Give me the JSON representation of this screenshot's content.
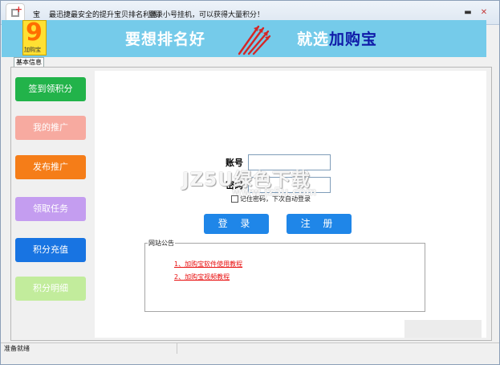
{
  "titlebar": {
    "app_name": "宝",
    "slogan1": "最迅捷最安全的提升宝贝排名利器！",
    "slogan2": "登录小号挂机，可以获得大量积分！",
    "min_glyph": "▬",
    "close_glyph": "✕"
  },
  "banner": {
    "logo_big": "9",
    "logo_small": "加购宝",
    "text1": "要想排名好",
    "text2_prefix": "就选",
    "brand": "加购宝"
  },
  "tabs": [
    {
      "label": "基本信息"
    }
  ],
  "sidebar": {
    "items": [
      {
        "label": "签到领积分",
        "color": "#22b34a"
      },
      {
        "label": "我的推广",
        "color": "#f7aaa0"
      },
      {
        "label": "发布推广",
        "color": "#f57d18"
      },
      {
        "label": "领取任务",
        "color": "#c49df0"
      },
      {
        "label": "积分充值",
        "color": "#1874e2"
      },
      {
        "label": "积分明细",
        "color": "#c2ec9c"
      }
    ]
  },
  "login": {
    "account_label": "账号",
    "account_value": "",
    "password_label": "密码",
    "password_value": "",
    "remember_label": "记住密码，下次自动登录",
    "login_button": "登 录",
    "register_button": "注 册"
  },
  "notice": {
    "title": "网站公告",
    "links": [
      {
        "text": "1、加购宝软件使用教程"
      },
      {
        "text": "2、加购宝视频教程"
      }
    ]
  },
  "watermark": {
    "line1": "JZ5U绿色下载",
    "line2": "www.jz5u.com"
  },
  "statusbar": {
    "text": "准备就绪"
  }
}
